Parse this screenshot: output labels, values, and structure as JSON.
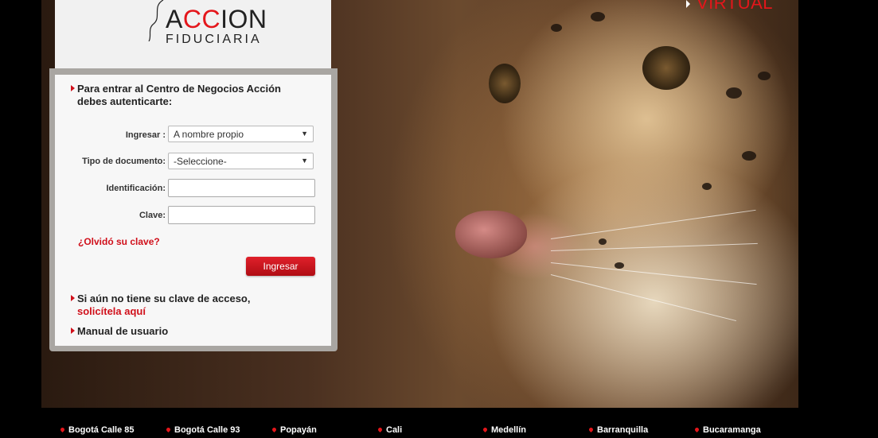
{
  "brand": {
    "logo_part1": "A",
    "logo_red": "CC",
    "logo_part2": "ION",
    "logo_sub": "FIDUCIARIA",
    "virtual_label": "VIRTUAL",
    "accent_color": "#e4161b"
  },
  "login": {
    "intro_line1": "Para entrar al Centro de Negocios Acción",
    "intro_line2": "debes autenticarte:",
    "ingresar_label": "Ingresar :",
    "ingresar_value": "A nombre propio",
    "tipo_doc_label": "Tipo de documento:",
    "tipo_doc_value": "-Seleccione-",
    "identificacion_label": "Identificación:",
    "identificacion_value": "",
    "clave_label": "Clave:",
    "clave_value": "",
    "forgot_link": "¿Olvidó su clave?",
    "submit_label": "Ingresar",
    "no_key_text": "Si aún no tiene su clave de acceso,",
    "request_link": "solicítela aquí",
    "manual_link": "Manual de usuario"
  },
  "footer": {
    "offices": [
      "Bogotá Calle 85",
      "Bogotá Calle 93",
      "Popayán",
      "Cali",
      "Medellín",
      "Barranquilla",
      "Bucaramanga"
    ]
  }
}
